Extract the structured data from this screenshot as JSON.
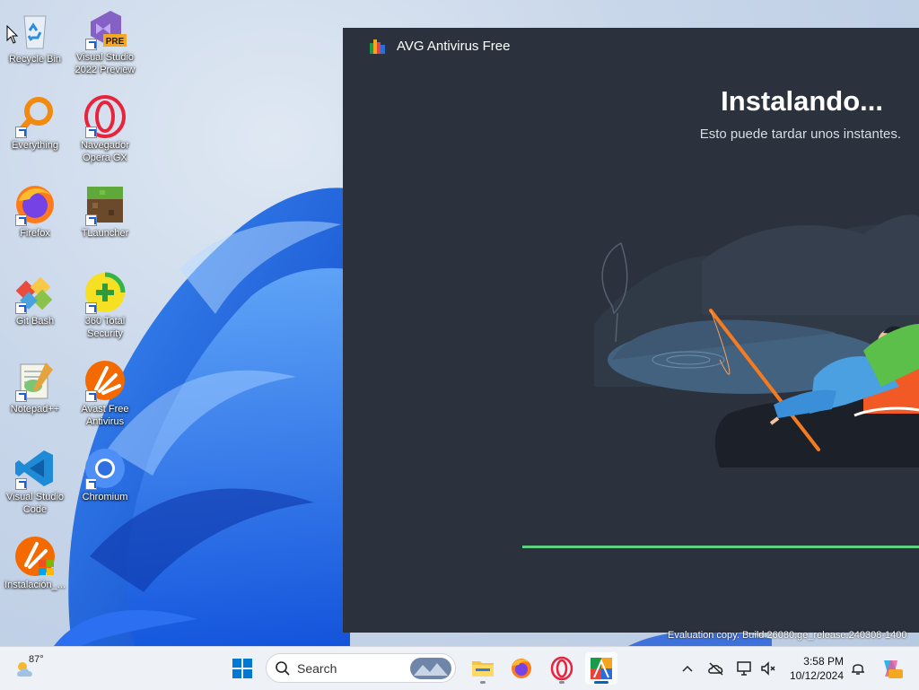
{
  "desktop": {
    "icons": [
      {
        "label": "Recycle Bin"
      },
      {
        "label": "Visual Studio 2022 Preview",
        "badge": "PRE"
      },
      {
        "label": "Everything"
      },
      {
        "label": "Navegador Opera GX"
      },
      {
        "label": "Firefox"
      },
      {
        "label": "TLauncher"
      },
      {
        "label": "Git Bash"
      },
      {
        "label": "360 Total Security"
      },
      {
        "label": "Notepad++"
      },
      {
        "label": "Avast Free Antivirus"
      },
      {
        "label": "Visual Studio Code"
      },
      {
        "label": "Chromium"
      },
      {
        "label": "Instalación_..."
      }
    ],
    "evaluation_text": "Evaluation copy. Build 26080.ge_release.240308-1400"
  },
  "avg_window": {
    "title": "AVG Antivirus Free",
    "heading": "Instalando...",
    "subtitle": "Esto puede tardar unos instantes.",
    "progress": 1.0,
    "accent_color": "#5fcf80",
    "background_color": "#2b323d"
  },
  "taskbar": {
    "weather": {
      "temp": "87°",
      "icon": "partly-cloudy-icon"
    },
    "search": {
      "label": "Search"
    },
    "apps": [
      {
        "name": "start-icon"
      },
      {
        "name": "file-explorer-icon"
      },
      {
        "name": "firefox-icon"
      },
      {
        "name": "opera-icon"
      },
      {
        "name": "avg-icon"
      }
    ],
    "clock": {
      "time": "3:58 PM",
      "date": "10/12/2024"
    },
    "tray": [
      "chevron-up-icon",
      "onedrive-icon",
      "network-icon",
      "volume-icon",
      "notification-icon",
      "copilot-icon"
    ]
  }
}
